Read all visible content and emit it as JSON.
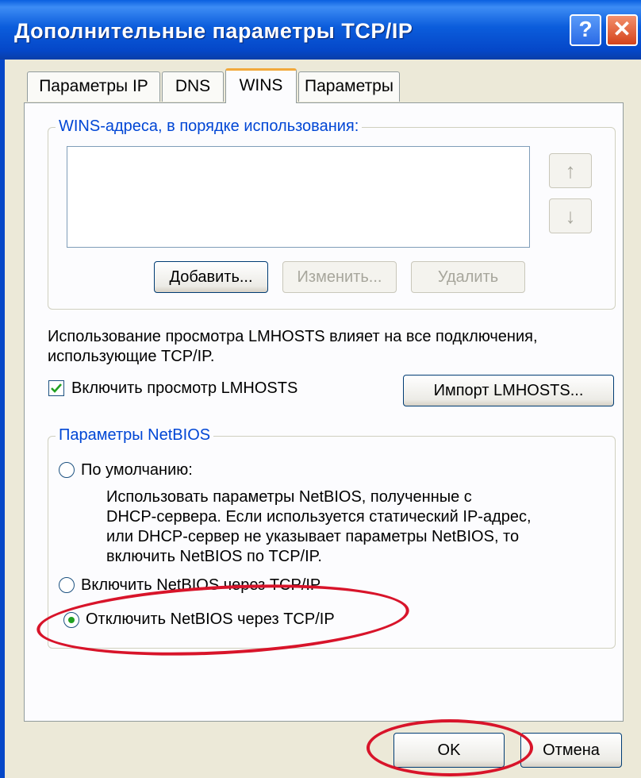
{
  "window": {
    "title": "Дополнительные параметры TCP/IP",
    "help_button": "?",
    "close_button": "✕"
  },
  "tabs": [
    {
      "label": "Параметры IP",
      "active": false
    },
    {
      "label": "DNS",
      "active": false
    },
    {
      "label": "WINS",
      "active": true
    },
    {
      "label": "Параметры",
      "active": false
    }
  ],
  "wins": {
    "group_label": "WINS-адреса, в порядке использования:",
    "addresses": [],
    "up_icon": "arrow-up-icon",
    "down_icon": "arrow-down-icon",
    "add_button": "Добавить...",
    "edit_button": "Изменить...",
    "remove_button": "Удалить"
  },
  "lmhosts": {
    "info_line1": "Использование просмотра LMHOSTS влияет на все подключения,",
    "info_line2": "использующие TCP/IP.",
    "enable_label": "Включить просмотр LMHOSTS",
    "enable_checked": true,
    "import_button": "Импорт LMHOSTS..."
  },
  "netbios": {
    "group_label": "Параметры NetBIOS",
    "options": [
      {
        "label": "По умолчанию:",
        "selected": false
      },
      {
        "label": "Включить NetBIOS через TCP/IP",
        "selected": false
      },
      {
        "label": "Отключить NetBIOS через TCP/IP",
        "selected": true
      }
    ],
    "default_desc": [
      "Использовать параметры NetBIOS, полученные с",
      "DHCP-сервера. Если используется статический IP-адрес,",
      "или DHCP-сервер не указывает параметры NetBIOS, то",
      "включить NetBIOS по TCP/IP."
    ]
  },
  "footer": {
    "ok_button": "OK",
    "cancel_button": "Отмена"
  },
  "annotation_color": "#d8142a"
}
